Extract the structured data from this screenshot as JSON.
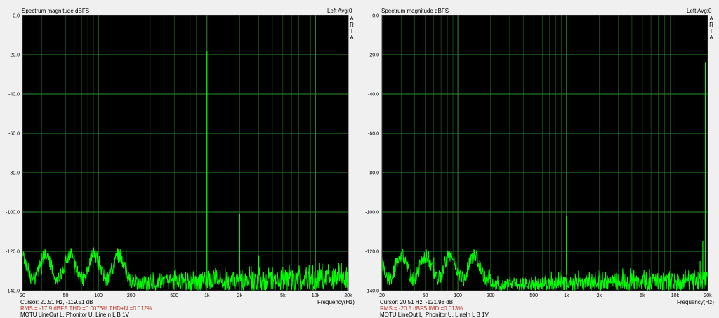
{
  "chart_data": [
    {
      "type": "line",
      "title": "Spectrum magnitude dBFS",
      "mode": "Left  Avg:0",
      "watermark": [
        "A",
        "R",
        "T",
        "A"
      ],
      "xlabel": "Frequency(Hz)",
      "xscale": "log",
      "xlim": [
        20,
        20000
      ],
      "ylim": [
        -140,
        0
      ],
      "y_ticks": [
        "0.0",
        "-20.0",
        "-40.0",
        "-60.0",
        "-80.0",
        "-100.0",
        "-120.0",
        "-140.0"
      ],
      "x_ticks": [
        {
          "value": 20,
          "label": "20"
        },
        {
          "value": 50,
          "label": "50"
        },
        {
          "value": 100,
          "label": "100"
        },
        {
          "value": 200,
          "label": "200"
        },
        {
          "value": 500,
          "label": "500"
        },
        {
          "value": 1000,
          "label": "1k"
        },
        {
          "value": 2000,
          "label": "2k"
        },
        {
          "value": 5000,
          "label": "5k"
        },
        {
          "value": 10000,
          "label": "10k"
        },
        {
          "value": 20000,
          "label": "20k"
        }
      ],
      "grid": true,
      "background": "#000000",
      "line_color": "#00ff00",
      "grid_color": "#2e8b2e",
      "noise_floor": [
        -140,
        -128
      ],
      "peaks": [
        {
          "x": 1000,
          "y": -18
        },
        {
          "x": 2000,
          "y": -101
        },
        {
          "x": 3000,
          "y": -122
        },
        {
          "x": 5000,
          "y": -128
        },
        {
          "x": 180,
          "y": -119
        },
        {
          "x": 60,
          "y": -122
        },
        {
          "x": 30,
          "y": -121
        }
      ],
      "cursor": "Cursor: 20.51 Hz, -119.51 dB",
      "stats": "RMS =  -17.9 dBFS   THD =0.0076%   THD+N =0.012%",
      "device": "MOTU LineOut L, Phonitor U, LineIn L B 1V"
    },
    {
      "type": "line",
      "title": "Spectrum magnitude dBFS",
      "mode": "Left  Avg:0",
      "watermark": [
        "A",
        "R",
        "T",
        "A"
      ],
      "xlabel": "Frequency(Hz)",
      "xscale": "log",
      "xlim": [
        20,
        20000
      ],
      "ylim": [
        -140,
        0
      ],
      "y_ticks": [
        "0.0",
        "-20.0",
        "-40.0",
        "-60.0",
        "-80.0",
        "-100.0",
        "-120.0",
        "-140.0"
      ],
      "x_ticks": [
        {
          "value": 20,
          "label": "20"
        },
        {
          "value": 50,
          "label": "50"
        },
        {
          "value": 100,
          "label": "100"
        },
        {
          "value": 200,
          "label": "200"
        },
        {
          "value": 500,
          "label": "500"
        },
        {
          "value": 1000,
          "label": "1k"
        },
        {
          "value": 2000,
          "label": "2k"
        },
        {
          "value": 5000,
          "label": "5k"
        },
        {
          "value": 10000,
          "label": "10k"
        },
        {
          "value": 20000,
          "label": "20k"
        }
      ],
      "grid": true,
      "background": "#000000",
      "line_color": "#00ff00",
      "grid_color": "#2e8b2e",
      "noise_floor": [
        -140,
        -130
      ],
      "peaks": [
        {
          "x": 19000,
          "y": -24
        },
        {
          "x": 18000,
          "y": -115
        },
        {
          "x": 17000,
          "y": -125
        },
        {
          "x": 1000,
          "y": -102
        },
        {
          "x": 60,
          "y": -123
        },
        {
          "x": 20,
          "y": -122
        }
      ],
      "cursor": "Cursor: 20.51 Hz, -121.98 dB",
      "stats": "RMS =  -20.5 dBFS   IMD =0.013%",
      "device": "MOTU LineOut L, Phonitor U, LineIn L B 1V"
    }
  ]
}
